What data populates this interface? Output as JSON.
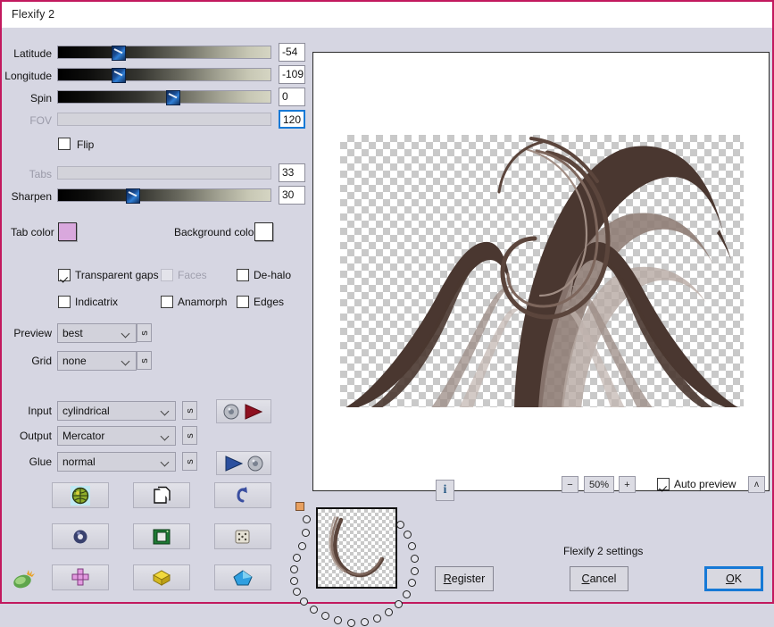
{
  "window": {
    "title": "Flexify 2",
    "border_color": "#c2195e",
    "panel_bg": "#d6d6e2"
  },
  "sliders": [
    {
      "label": "Latitude",
      "value": "-54",
      "pct": 25,
      "enabled": true,
      "focused": false
    },
    {
      "label": "Longitude",
      "value": "-109",
      "pct": 25,
      "enabled": true,
      "focused": false
    },
    {
      "label": "Spin",
      "value": "0",
      "pct": 51,
      "enabled": true,
      "focused": false
    },
    {
      "label": "FOV",
      "value": "120",
      "pct": 0,
      "enabled": false,
      "focused": true
    }
  ],
  "flip": {
    "label": "Flip",
    "checked": false
  },
  "sliders2": [
    {
      "label": "Tabs",
      "value": "33",
      "pct": 0,
      "enabled": false,
      "focused": false
    },
    {
      "label": "Sharpen",
      "value": "30",
      "pct": 32,
      "enabled": true,
      "focused": false
    }
  ],
  "colors": {
    "tab_color_label": "Tab color",
    "tab_color_hex": "#d9a8dd",
    "background_color_label": "Background color",
    "background_color_hex": "#ffffff"
  },
  "checkboxes": [
    {
      "label": "Transparent gaps",
      "checked": true,
      "enabled": true
    },
    {
      "label": "Faces",
      "checked": false,
      "enabled": false
    },
    {
      "label": "De-halo",
      "checked": false,
      "enabled": true
    },
    {
      "label": "Indicatrix",
      "checked": false,
      "enabled": true
    },
    {
      "label": "Anamorph",
      "checked": false,
      "enabled": true
    },
    {
      "label": "Edges",
      "checked": false,
      "enabled": true
    }
  ],
  "dropdowns": [
    {
      "label": "Preview",
      "value": "best",
      "side_button": "s"
    },
    {
      "label": "Grid",
      "value": "none",
      "side_button": "s"
    },
    {
      "label": "Input",
      "value": "cylindrical",
      "side_button": "s"
    },
    {
      "label": "Output",
      "value": "Mercator",
      "side_button": "s"
    },
    {
      "label": "Glue",
      "value": "normal",
      "side_button": "s"
    }
  ],
  "transform_buttons": [
    {
      "name": "sphere-to-plane-button"
    },
    {
      "name": "plane-to-sphere-button"
    }
  ],
  "icon_buttons": [
    {
      "name": "globe-icon"
    },
    {
      "name": "pages-icon"
    },
    {
      "name": "undo-arrow-icon"
    },
    {
      "name": "torus-icon"
    },
    {
      "name": "chip-icon"
    },
    {
      "name": "dice-icon"
    },
    {
      "name": "cross-cube-icon"
    },
    {
      "name": "gold-box-icon"
    },
    {
      "name": "blue-gem-icon"
    }
  ],
  "zoom": {
    "minus_label": "−",
    "level": "50%",
    "plus_label": "+"
  },
  "auto_preview": {
    "label": "Auto preview",
    "checked": true
  },
  "collapse_button": {
    "label": "ʌ"
  },
  "info_button": {
    "label": "i"
  },
  "status_text": "Flexify 2 settings",
  "buttons": {
    "register": {
      "pre": "R",
      "post": "egister"
    },
    "cancel": {
      "pre": "C",
      "post": "ancel"
    },
    "ok": {
      "pre": "O",
      "post": "K"
    }
  }
}
